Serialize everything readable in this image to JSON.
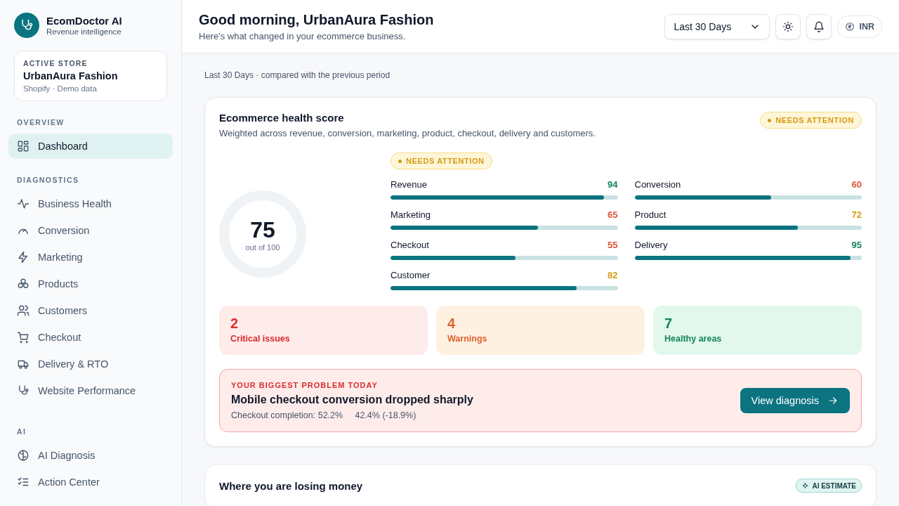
{
  "brand": {
    "name": "EcomDoctor AI",
    "tagline": "Revenue intelligence"
  },
  "store": {
    "label": "ACTIVE STORE",
    "name": "UrbanAura Fashion",
    "meta": "Shopify · Demo data"
  },
  "sidebar": {
    "sections": [
      {
        "title": "OVERVIEW",
        "items": [
          {
            "label": "Dashboard",
            "selected": true
          }
        ]
      },
      {
        "title": "DIAGNOSTICS",
        "items": [
          {
            "label": "Business Health",
            "selected": false
          },
          {
            "label": "Conversion",
            "selected": false
          },
          {
            "label": "Marketing",
            "selected": false
          },
          {
            "label": "Products",
            "selected": false
          },
          {
            "label": "Customers",
            "selected": false
          },
          {
            "label": "Checkout",
            "selected": false
          },
          {
            "label": "Delivery & RTO",
            "selected": false
          },
          {
            "label": "Website Performance",
            "selected": false
          }
        ]
      },
      {
        "title": "AI",
        "items": [
          {
            "label": "AI Diagnosis",
            "selected": false
          },
          {
            "label": "Action Center",
            "selected": false
          }
        ]
      }
    ]
  },
  "header": {
    "title": "Good morning, UrbanAura Fashion",
    "subtitle": "Here's what changed in your ecommerce business.",
    "period": "Last 30 Days",
    "currency": "INR"
  },
  "caption": "Last 30 Days · compared with the previous period",
  "health": {
    "title": "Ecommerce health score",
    "subtitle": "Weighted across revenue, conversion, marketing, product, checkout, delivery and customers.",
    "badge": "NEEDS ATTENTION",
    "inner_badge": "NEEDS ATTENTION",
    "score": "75",
    "score_caption": "out of 100",
    "metrics": [
      {
        "label": "Revenue",
        "value": "94",
        "level": 0.94,
        "color": "#15845a"
      },
      {
        "label": "Conversion",
        "value": "60",
        "level": 0.6,
        "color": "#dc5434"
      },
      {
        "label": "Marketing",
        "value": "65",
        "level": 0.65,
        "color": "#dc5434"
      },
      {
        "label": "Product",
        "value": "72",
        "level": 0.72,
        "color": "#d49b14"
      },
      {
        "label": "Checkout",
        "value": "55",
        "level": 0.55,
        "color": "#dc5434"
      },
      {
        "label": "Delivery",
        "value": "95",
        "level": 0.95,
        "color": "#15845a"
      },
      {
        "label": "Customer",
        "value": "82",
        "level": 0.82,
        "color": "#d49b14"
      }
    ],
    "tiles": [
      {
        "kind": "critical",
        "count": "2",
        "label": "Critical issues"
      },
      {
        "kind": "warning",
        "count": "4",
        "label": "Warnings"
      },
      {
        "kind": "healthy",
        "count": "7",
        "label": "Healthy areas"
      }
    ],
    "problem": {
      "eyebrow": "YOUR BIGGEST PROBLEM TODAY",
      "title": "Mobile checkout conversion dropped sharply",
      "detail": "Checkout completion: 52.2%     42.4% (-18.9%)",
      "action": "View diagnosis"
    }
  },
  "losses": {
    "title": "Where you are losing money",
    "badge": "AI ESTIMATE"
  }
}
